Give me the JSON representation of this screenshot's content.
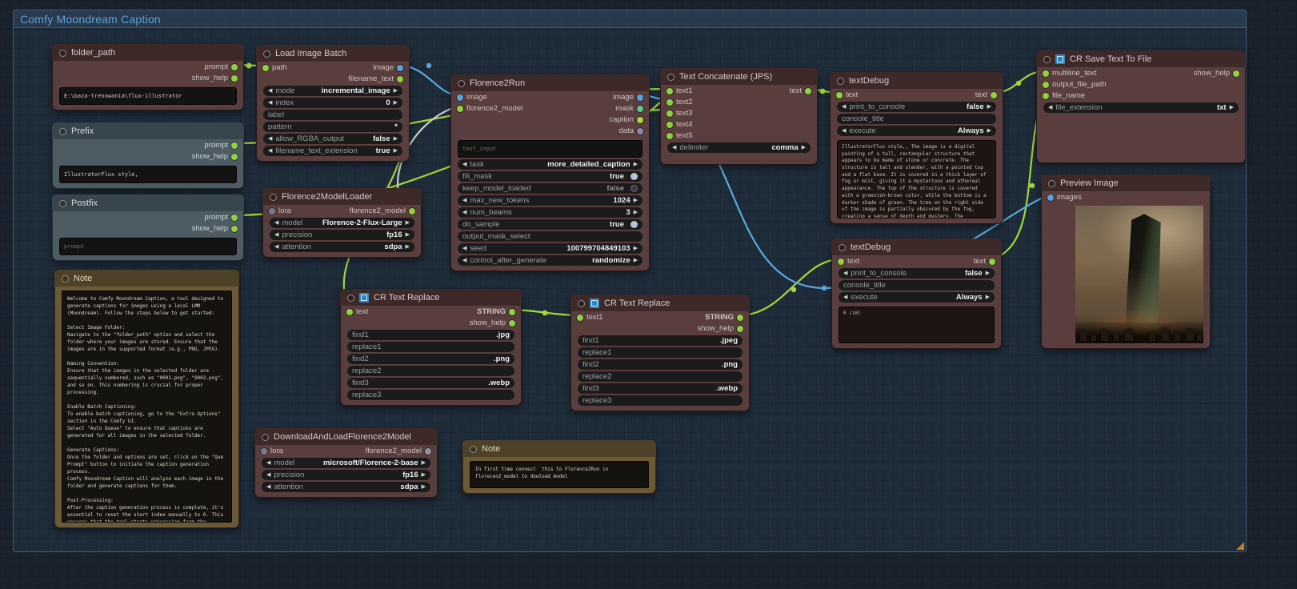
{
  "group": {
    "title": "Comfy Moondream Caption"
  },
  "colors": {
    "wire_green": "#a2d838",
    "wire_blue": "#58a8e0",
    "wire_gray": "#cfcfcf",
    "group_title": "#5fa0d8",
    "resize_handle": "#c8782a"
  },
  "nodes": {
    "folder_path": {
      "title": "folder_path",
      "outputs": [
        "prompt",
        "show_help"
      ],
      "value": "E:\\baza-trenowania\\flux-illustrator"
    },
    "prefix": {
      "title": "Prefix",
      "outputs": [
        "prompt",
        "show_help"
      ],
      "value": "IllustratorFlux style,"
    },
    "postfix": {
      "title": "Postfix",
      "outputs": [
        "prompt",
        "show_help"
      ],
      "placeholder": "prompt"
    },
    "note1": {
      "title": "Note",
      "text": "Welcome to Comfy Moondream Caption, a tool designed to generate captions for images using a local LMM (Moondream). Follow the steps below to get started:\n\nSelect Image Folder:\nNavigate to the \"folder_path\" option and select the folder where your images are stored. Ensure that the images are in the supported format (e.g., PNG, JPEG).\n\nNaming Convention:\nEnsure that the images in the selected folder are sequentially numbered, such as \"0001.png\", \"0002.png\", and so on. This numbering is crucial for proper processing.\n\nEnable Batch Captioning:\nTo enable batch captioning, go to the \"Extra Options\" section in the Comfy UI.\nSelect \"Auto Queue\" to ensure that captions are generated for all images in the selected folder.\n\nGenerate Captions:\nOnce the folder and options are set, click on the \"Que Prompt\" button to initiate the caption generation process.\nComfy Moondream Caption will analyze each image in the folder and generate captions for them.\n\nPost-Processing:\nAfter the caption generation process is complete, it's essential to reset the start index manually to 0. This ensures that the tool starts processing from the beginning for the next dataset.\n\nRepeat for Additional Datasets:\nIf you have more datasets to analyze, repeat the process by selecting a new folder containing images and following steps 2 to 5."
    },
    "load_image_batch": {
      "title": "Load Image Batch",
      "inputs": [
        "path"
      ],
      "outputs": [
        "image",
        "filename_text"
      ],
      "widgets": [
        {
          "label": "mode",
          "value": "incremental_image"
        },
        {
          "label": "index",
          "value": "0"
        },
        {
          "label": "label",
          "value": ""
        },
        {
          "label": "pattern",
          "value": "*"
        },
        {
          "label": "allow_RGBA_output",
          "value": "false"
        },
        {
          "label": "filename_text_extension",
          "value": "true"
        }
      ]
    },
    "florence2_model_loader": {
      "title": "Florence2ModelLoader",
      "inputs": [
        "lora"
      ],
      "outputs": [
        "florence2_model"
      ],
      "widgets": [
        {
          "label": "model",
          "value": "Florence-2-Flux-Large"
        },
        {
          "label": "precision",
          "value": "fp16"
        },
        {
          "label": "attention",
          "value": "sdpa"
        }
      ]
    },
    "florence2_run": {
      "title": "Florence2Run",
      "inputs": [
        "image",
        "florence2_model"
      ],
      "outputs": [
        "image",
        "mask",
        "caption",
        "data"
      ],
      "placeholder": "text_input",
      "widgets": [
        {
          "label": "task",
          "value": "more_detailed_caption"
        },
        {
          "label": "fill_mask",
          "value": "true"
        },
        {
          "label": "keep_model_loaded",
          "value": "false"
        },
        {
          "label": "max_new_tokens",
          "value": "1024"
        },
        {
          "label": "num_beams",
          "value": "3"
        },
        {
          "label": "do_sample",
          "value": "true"
        },
        {
          "label": "output_mask_select",
          "value": ""
        },
        {
          "label": "seed",
          "value": "100799704849103"
        },
        {
          "label": "control_after_generate",
          "value": "randomize"
        }
      ]
    },
    "cr_text_replace_1": {
      "title": "CR Text Replace",
      "inputs": [
        "text"
      ],
      "outputs": [
        "STRING",
        "show_help"
      ],
      "widgets": [
        {
          "label": "find1",
          "value": ".jpg"
        },
        {
          "label": "replace1",
          "value": ""
        },
        {
          "label": "find2",
          "value": ".png"
        },
        {
          "label": "replace2",
          "value": ""
        },
        {
          "label": "find3",
          "value": ".webp"
        },
        {
          "label": "replace3",
          "value": ""
        }
      ]
    },
    "cr_text_replace_2": {
      "title": "CR Text Replace",
      "inputs": [
        "text1"
      ],
      "outputs": [
        "STRING",
        "show_help"
      ],
      "widgets": [
        {
          "label": "find1",
          "value": ".jpeg"
        },
        {
          "label": "replace1",
          "value": ""
        },
        {
          "label": "find2",
          "value": ".png"
        },
        {
          "label": "replace2",
          "value": ""
        },
        {
          "label": "find3",
          "value": ".webp"
        },
        {
          "label": "replace3",
          "value": ""
        }
      ]
    },
    "download_florence2": {
      "title": "DownloadAndLoadFlorence2Model",
      "inputs": [
        "lora"
      ],
      "outputs": [
        "florence2_model"
      ],
      "widgets": [
        {
          "label": "model",
          "value": "microsoft/Florence-2-base"
        },
        {
          "label": "precision",
          "value": "fp16"
        },
        {
          "label": "attention",
          "value": "sdpa"
        }
      ]
    },
    "note2": {
      "title": "Note",
      "text": "In first time connect  this to Florence2Run in florecen2_model to dowload model"
    },
    "text_concatenate": {
      "title": "Text Concatenate (JPS)",
      "inputs": [
        "text1",
        "text2",
        "text3",
        "text4",
        "text5"
      ],
      "outputs": [
        "text"
      ],
      "widgets": [
        {
          "label": "delimiter",
          "value": "comma"
        }
      ]
    },
    "text_debug_1": {
      "title": "textDebug",
      "inputs": [
        "text"
      ],
      "outputs": [
        "text"
      ],
      "widgets": [
        {
          "label": "print_to_console",
          "value": "false"
        },
        {
          "label": "console_title",
          "value": ""
        },
        {
          "label": "execute",
          "value": "Always"
        }
      ],
      "text": "IllustratorFlux style,, The image is a digital painting of a tall, rectangular structure that appears to be made of stone or concrete. The structure is tall and slender, with a pointed top and a flat base. It is covered in a thick layer of fog or mist, giving it a mysterious and ethereal appearance. The top of the structure is covered with a greenish-brown color, while the bottom is a darker shade of green. The tree on the right side of the image is partially obscured by the fog, creating a sense of depth and mystery. The background is a mix of light and dark colors, with hints of orange and yellow, creating an ethereal and mysterious atmosphere. In the foreground, there are several rows of headstones of different sizes and shapes, all of which are covered in dirt and debris. The overall mood of the painting is eerie and mysterious."
    },
    "text_debug_2": {
      "title": "textDebug",
      "inputs": [
        "text"
      ],
      "outputs": [
        "text"
      ],
      "widgets": [
        {
          "label": "print_to_console",
          "value": "false"
        },
        {
          "label": "console_title",
          "value": ""
        },
        {
          "label": "execute",
          "value": "Always"
        }
      ],
      "text": "0 (10)"
    },
    "cr_save_text": {
      "title": "CR Save Text To File",
      "inputs": [
        "multiline_text",
        "output_file_path",
        "file_name"
      ],
      "outputs": [
        "show_help"
      ],
      "widgets": [
        {
          "label": "file_extension",
          "value": "txt"
        }
      ]
    },
    "preview_image": {
      "title": "Preview Image",
      "inputs": [
        "images"
      ]
    }
  }
}
